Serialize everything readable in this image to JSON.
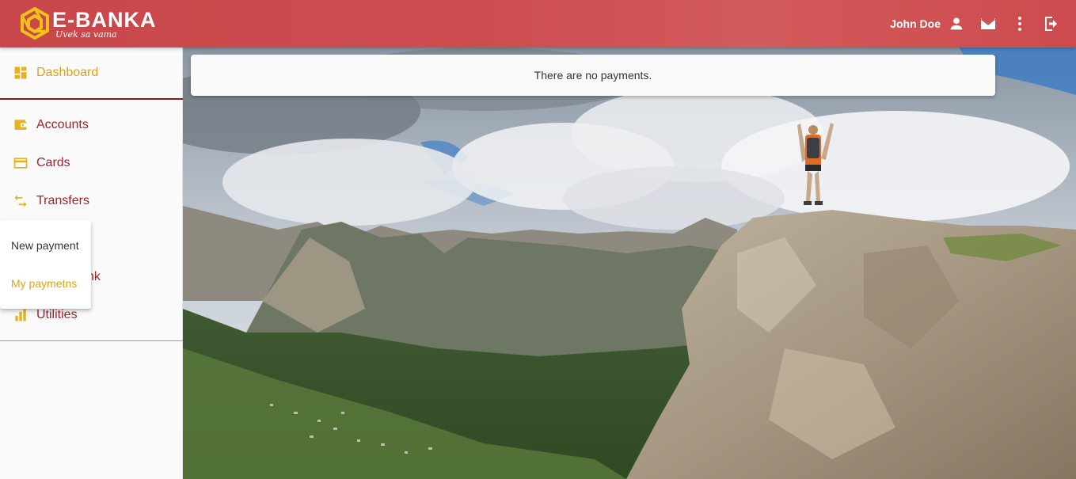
{
  "brand": {
    "name": "E-BANKA",
    "slogan": "Uvek sa vama"
  },
  "header": {
    "user_name": "John Doe",
    "icons": [
      "person-icon",
      "mail-icon",
      "more-vert-icon",
      "logout-icon"
    ]
  },
  "sidebar": {
    "items": [
      {
        "label": "Dashboard",
        "icon": "dashboard-icon"
      },
      {
        "label": "Accounts",
        "icon": "wallet-icon"
      },
      {
        "label": "Cards",
        "icon": "card-icon"
      },
      {
        "label": "Transfers",
        "icon": "swap-icon"
      },
      {
        "label": "nk",
        "icon": ""
      },
      {
        "label": "Utilities",
        "icon": "bar-chart-icon"
      }
    ],
    "submenu": [
      {
        "label": "New payment"
      },
      {
        "label": "My paymetns"
      }
    ]
  },
  "main": {
    "notice": "There are no payments."
  },
  "colors": {
    "header": "#cc4d50",
    "accent": "#d6a51b",
    "nav_text": "#a3232c"
  }
}
